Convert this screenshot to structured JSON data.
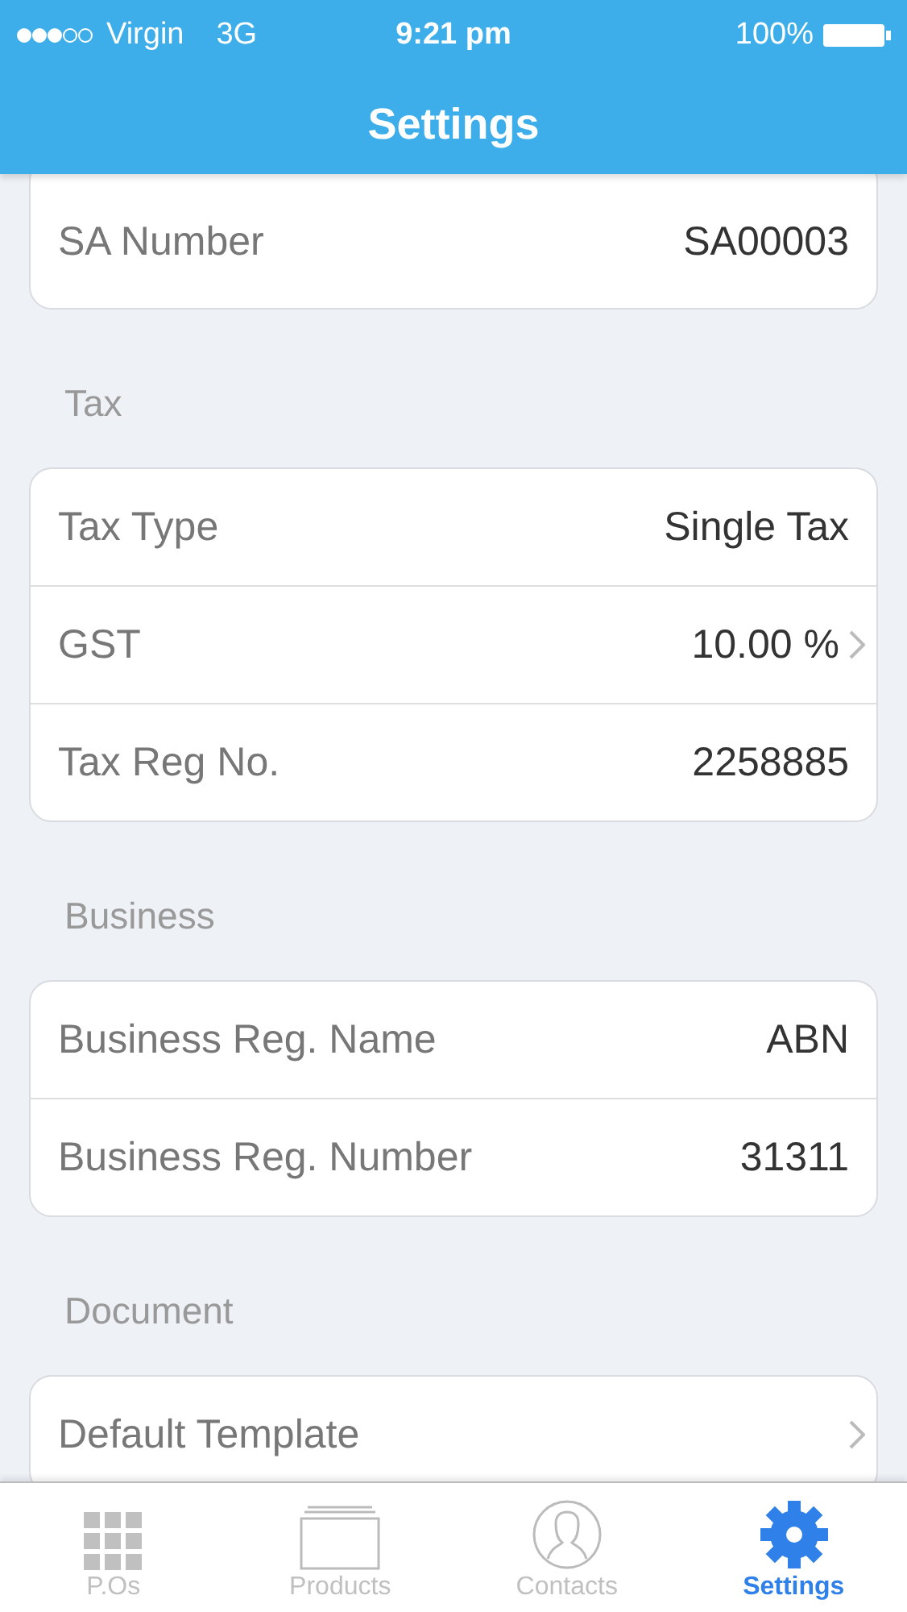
{
  "status_bar": {
    "carrier": "Virgin",
    "network": "3G",
    "time": "9:21 pm",
    "battery": "100%"
  },
  "nav_bar": {
    "title": "Settings"
  },
  "sections": [
    {
      "rows": [
        {
          "label": "SA Number",
          "value": "SA00003",
          "chevron": false
        }
      ]
    },
    {
      "header": "Tax",
      "rows": [
        {
          "label": "Tax Type",
          "value": "Single Tax",
          "chevron": false
        },
        {
          "label": "GST",
          "value": "10.00 %",
          "chevron": true
        },
        {
          "label": "Tax Reg No.",
          "value": "2258885",
          "chevron": false
        }
      ]
    },
    {
      "header": "Business",
      "rows": [
        {
          "label": "Business Reg. Name",
          "value": "ABN",
          "chevron": false
        },
        {
          "label": "Business Reg. Number",
          "value": "31311",
          "chevron": false
        }
      ]
    },
    {
      "header": "Document",
      "rows": [
        {
          "label": "Default Template",
          "chevron": true
        }
      ]
    }
  ],
  "tab_bar": [
    {
      "label": "P.Os",
      "selected": false
    },
    {
      "label": "Products",
      "selected": false
    },
    {
      "label": "Contacts",
      "selected": false
    },
    {
      "label": "Settings",
      "selected": true
    }
  ]
}
